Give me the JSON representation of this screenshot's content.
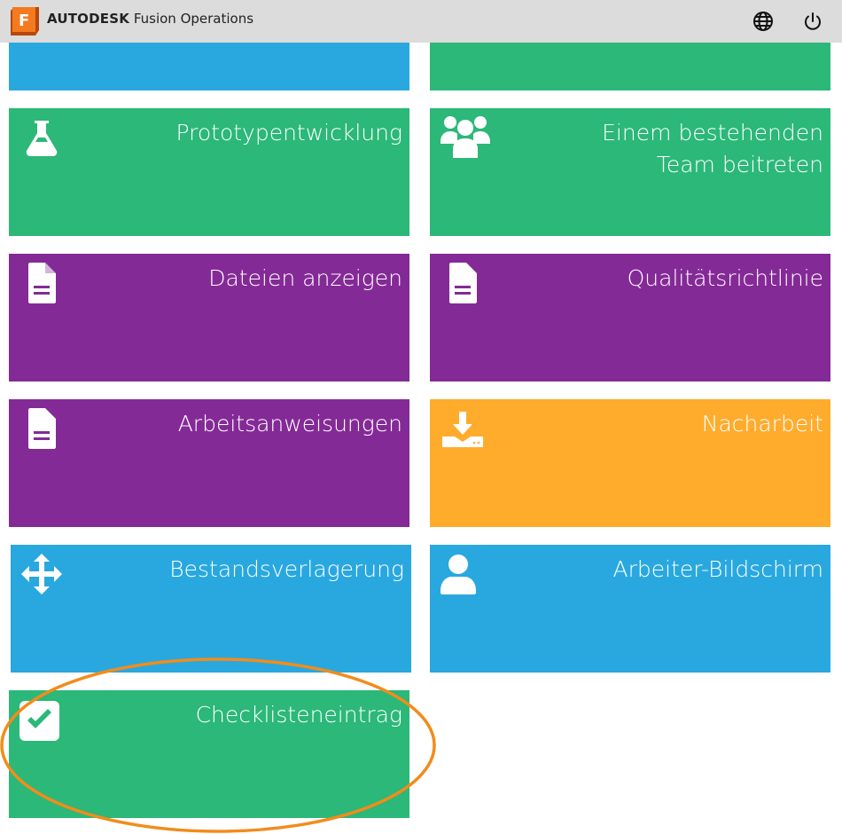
{
  "header": {
    "brand_bold": "AUTODESK",
    "brand_rest": "Fusion Operations",
    "logo_letter": "F",
    "icons": [
      "globe-icon",
      "power-icon"
    ]
  },
  "colors": {
    "blue": "#29a8e0",
    "green": "#2bb878",
    "purple": "#842a96",
    "orange": "#ffac2d",
    "highlight": "#f28c1c"
  },
  "tiles": [
    {
      "label": "Prototypentwicklung",
      "icon": "flask-icon",
      "color": "green"
    },
    {
      "label": "Einem bestehenden Team beitreten",
      "line1": "Einem bestehenden",
      "line2": "Team beitreten",
      "icon": "users-icon",
      "color": "green"
    },
    {
      "label": "Dateien anzeigen",
      "icon": "file-icon",
      "color": "purple"
    },
    {
      "label": "Qualitätsrichtlinie",
      "icon": "file-icon",
      "color": "purple"
    },
    {
      "label": "Arbeitsanweisungen",
      "icon": "file-icon",
      "color": "purple"
    },
    {
      "label": "Nacharbeit",
      "icon": "download-icon",
      "color": "orange"
    },
    {
      "label": "Bestandsverlagerung",
      "icon": "move-icon",
      "color": "blue"
    },
    {
      "label": "Arbeiter-Bildschirm",
      "icon": "user-icon",
      "color": "blue"
    },
    {
      "label": "Checklisteneintrag",
      "icon": "checkbox-icon",
      "color": "green"
    }
  ]
}
